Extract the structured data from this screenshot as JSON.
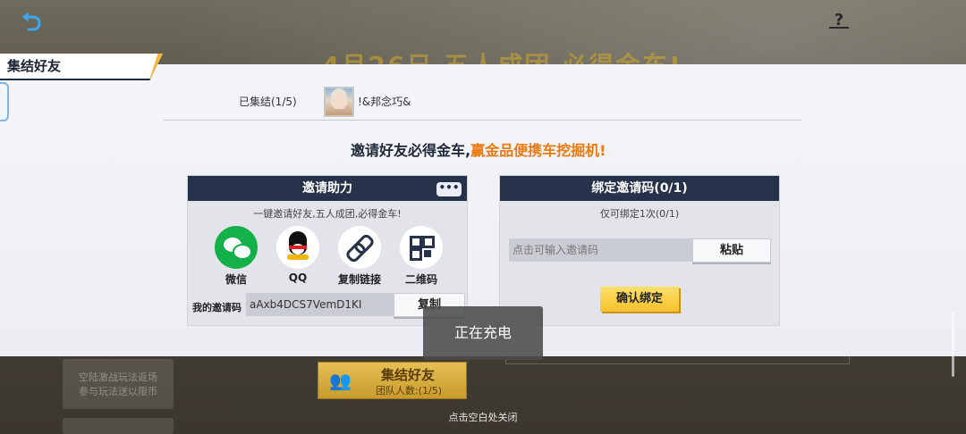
{
  "background": {
    "banner": "4月26日 五人成团 必得金车!",
    "side_card_title": "空陆激战玩法返场",
    "side_card_sub": "参与玩法送以限币"
  },
  "dialog": {
    "title": "集结好友",
    "assembled_label": "已集结(1/5)",
    "player_name": "!&邦念巧&",
    "headline_main": "邀请好友必得金车,",
    "headline_highlight": "赢金品便携车挖掘机!",
    "invite_card": {
      "title": "邀请助力",
      "more_label": "•••",
      "subtitle": "一键邀请好友,五人成团,必得金车!",
      "share_options": [
        {
          "label": "微信",
          "icon": "wechat-icon"
        },
        {
          "label": "QQ",
          "icon": "qq-icon"
        },
        {
          "label": "复制链接",
          "icon": "link-icon"
        },
        {
          "label": "二维码",
          "icon": "qrcode-icon"
        }
      ],
      "code_label": "我的邀请码",
      "code_value": "aAxb4DCS7VemD1KI",
      "copy_label": "复制"
    },
    "bind_card": {
      "title": "绑定邀请码(0/1)",
      "subtitle": "仅可绑定1次(0/1)",
      "input_placeholder": "点击可输入邀请码",
      "paste_label": "粘贴",
      "confirm_label": "确认绑定"
    }
  },
  "toast": "正在充电",
  "team_button": {
    "title": "集结好友",
    "count": "团队人数:(1/5)"
  },
  "close_hint": "点击空白处关闭",
  "colors": {
    "header_navy": "#26324a",
    "highlight_orange": "#ee7a12",
    "confirm_yellow": "#f3c12d",
    "wechat_green": "#14b04a"
  }
}
